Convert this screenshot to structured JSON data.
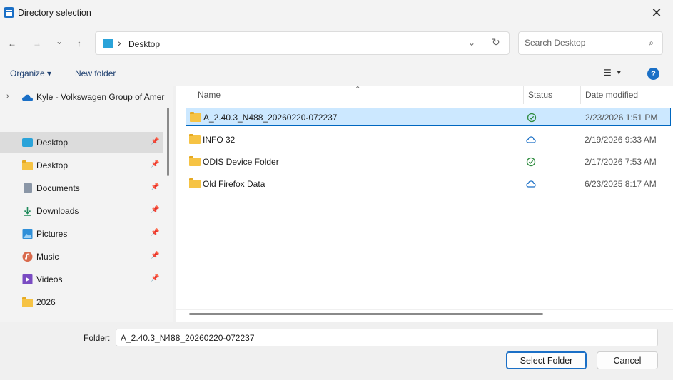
{
  "window": {
    "title": "Directory selection",
    "close_glyph": "✕",
    "accent": "#1a6fc6"
  },
  "navigation": {
    "back_glyph": "←",
    "forward_glyph": "→",
    "recent_glyph": "⌄",
    "up_glyph": "↑",
    "breadcrumb": "Desktop",
    "refresh_glyph": "↻",
    "dropdown_glyph": "⌄",
    "search_placeholder": "Search Desktop",
    "search_glyph": "⌕"
  },
  "command_bar": {
    "organize_label": "Organize ▾",
    "new_folder_label": "New folder",
    "help_glyph": "?",
    "view_glyph": "☰",
    "view_dd_glyph": "▾"
  },
  "sidebar": {
    "cloud_account": "Kyle - Volkswagen Group of Amer",
    "items": [
      {
        "label": "Desktop",
        "icon": "desktop-icon",
        "pinned": true,
        "selected": true
      },
      {
        "label": "Desktop",
        "icon": "folder-icon",
        "pinned": true
      },
      {
        "label": "Documents",
        "icon": "documents-icon",
        "pinned": true
      },
      {
        "label": "Downloads",
        "icon": "downloads-icon",
        "pinned": true
      },
      {
        "label": "Pictures",
        "icon": "pictures-icon",
        "pinned": true
      },
      {
        "label": "Music",
        "icon": "music-icon",
        "pinned": true
      },
      {
        "label": "Videos",
        "icon": "videos-icon",
        "pinned": true
      },
      {
        "label": "2026",
        "icon": "folder-icon",
        "pinned": false
      }
    ]
  },
  "file_list": {
    "columns": {
      "name": "Name",
      "status": "Status",
      "date_modified": "Date modified"
    },
    "rows": [
      {
        "name": "A_2.40.3_N488_20260220-072237",
        "status": "synced",
        "date": "2/23/2026 1:51 PM",
        "selected": true
      },
      {
        "name": "INFO 32",
        "status": "cloud",
        "date": "2/19/2026 9:33 AM"
      },
      {
        "name": "ODIS Device Folder",
        "status": "synced",
        "date": "2/17/2026 7:53 AM"
      },
      {
        "name": "Old Firefox Data",
        "status": "cloud",
        "date": "6/23/2025 8:17 AM"
      }
    ]
  },
  "footer": {
    "folder_label": "Folder:",
    "folder_value": "A_2.40.3_N488_20260220-072237",
    "select_label": "Select Folder",
    "cancel_label": "Cancel"
  }
}
